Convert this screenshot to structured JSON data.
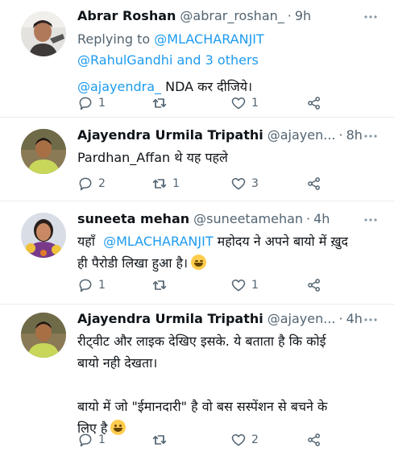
{
  "tweets": [
    {
      "name": "Abrar Roshan",
      "handle": "@abrar_roshan_",
      "time": "9h",
      "replying_prefix": "Replying to",
      "replying_handle": "@MLACHARANJIT",
      "replying_others": "@RahulGandhi and 3 others",
      "text_mention": "@ajayendra_",
      "text": " NDA कर दीजिये।",
      "replies": "1",
      "retweets": "",
      "likes": "1"
    },
    {
      "name": "Ajayendra Urmila Tripathi",
      "handle": "@ajayen...",
      "time": "8h",
      "text": "Pardhan_Affan थे यह पहले",
      "replies": "2",
      "retweets": "1",
      "likes": "3"
    },
    {
      "name": "suneeta mehan",
      "handle": "@suneetamehan",
      "time": "4h",
      "text_pre": "यहाँ  ",
      "text_mention": "@MLACHARANJIT",
      "text_line1_post": " महोदय ने अपने बायो में ख़ुद",
      "text_line2": "ही पैरोडी लिखा हुआ है।",
      "emoji": "face-with-tears-of-joy",
      "replies": "1",
      "retweets": "",
      "likes": "1"
    },
    {
      "name": "Ajayendra Urmila Tripathi",
      "handle": "@ajayen...",
      "time": "4h",
      "text_line1": "रीट्वीट और लाइक देखिए इसके. ये बताता है कि कोई",
      "text_line2": "बायो नही देखता।",
      "text_line3": "बायो में जो \"ईमानदारी\" है वो बस सस्पेंशन से बचने के",
      "text_line4": "लिए है",
      "emoji": "grinning-face",
      "replies": "1",
      "retweets": "",
      "likes": "2"
    }
  ],
  "separator": "·",
  "colors": {
    "link": "#1d9bf0",
    "secondary": "#536471",
    "divider": "#e6ecf0"
  },
  "icons": [
    "reply-icon",
    "retweet-icon",
    "like-icon",
    "share-icon",
    "more-icon"
  ]
}
